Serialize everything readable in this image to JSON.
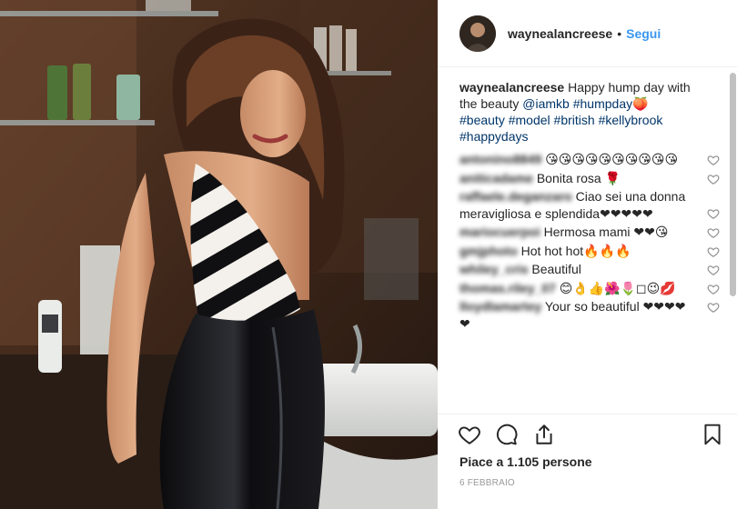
{
  "post": {
    "author": "waynealancreese",
    "follow_separator": "•",
    "follow_label": "Segui",
    "caption": {
      "username": "waynealancreese",
      "text": "Happy hump day with the beauty",
      "mention": "@iamkb",
      "hashtag_1": "#humpday",
      "emoji": "🍑",
      "hashtags": [
        "#beauty",
        "#model",
        "#british",
        "#kellybrook",
        "#happydays"
      ]
    },
    "comments": [
      {
        "user": "antonino8849",
        "text": "😘😘😘😘😘😘😘😘😘😘"
      },
      {
        "user": "aniticadame",
        "text": "Bonita rosa 🌹"
      },
      {
        "user": "raffaele.deganzaro",
        "text": "Ciao sei una donna meravigliosa e splendida❤❤❤❤❤"
      },
      {
        "user": "mariocuerpoi",
        "text": "Hermosa mami ❤❤😘"
      },
      {
        "user": "gmjphoto",
        "text": "Hot hot hot🔥🔥🔥"
      },
      {
        "user": "whiley_cris",
        "text": "Beautiful"
      },
      {
        "user": "thomas.riley_07",
        "text": "😊👌👍🌺🌷◻😉💋"
      },
      {
        "user": "lloydlamartey",
        "text": "Your so beautiful ❤❤❤❤❤"
      }
    ],
    "likes_label": "Piace a 1.105 persone",
    "date": "6 FEBBRAIO"
  },
  "icons": {
    "like": "heart-outline-icon",
    "comment": "speech-bubble-icon",
    "share": "share-arrow-icon",
    "save": "bookmark-icon",
    "comment_like": "small-heart-icon"
  },
  "colors": {
    "link": "#003569",
    "follow": "#3897f0",
    "meta": "#999999",
    "divider": "#efefef"
  }
}
